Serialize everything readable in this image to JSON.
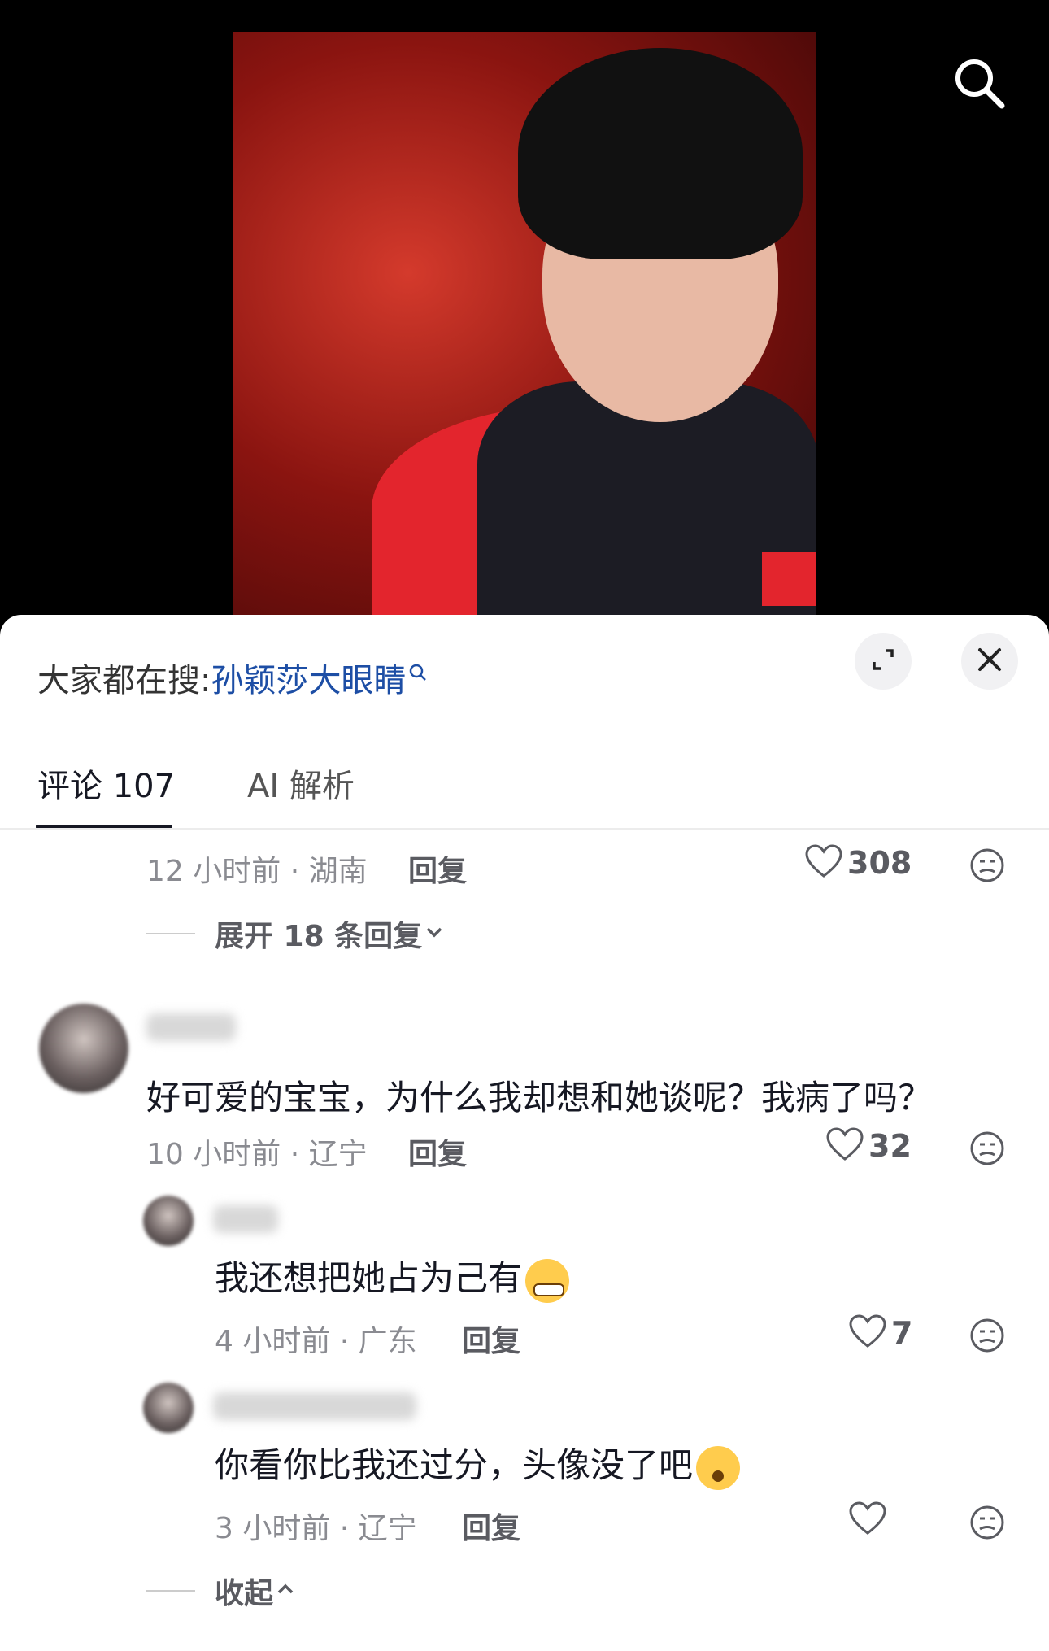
{
  "video": {
    "search_icon": "search-icon"
  },
  "sheet": {
    "trending_prefix": "大家都在搜:",
    "trending_keyword": "孙颖莎大眼睛",
    "expand_icon": "expand-icon",
    "close_icon": "close-icon"
  },
  "tabs": {
    "comments_label": "评论 107",
    "ai_label": "AI 解析"
  },
  "comments": {
    "first": {
      "meta": "12 小时前 · 湖南",
      "reply": "回复",
      "likes": "308",
      "expand": "展开 18 条回复"
    },
    "second": {
      "text": "好可爱的宝宝，为什么我却想和她谈呢？我病了吗？",
      "meta": "10 小时前 · 辽宁",
      "reply": "回复",
      "likes": "32"
    },
    "reply1": {
      "text": "我还想把她占为己有",
      "meta": "4 小时前 · 广东",
      "reply": "回复",
      "likes": "7"
    },
    "reply2": {
      "text": "你看你比我还过分，头像没了吧",
      "meta": "3 小时前 · 辽宁",
      "reply": "回复",
      "likes": ""
    },
    "collapse": "收起"
  }
}
